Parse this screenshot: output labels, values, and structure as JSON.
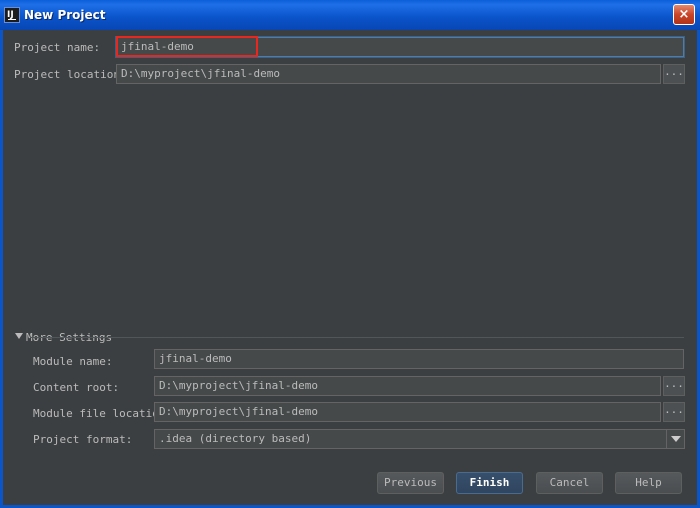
{
  "window": {
    "title": "New Project",
    "app_icon_letters": "IJ",
    "close_symbol": "×"
  },
  "form": {
    "project_name_label": "Project name:",
    "project_name_value": "jfinal-demo",
    "project_location_label": "Project location:",
    "project_location_value": "D:\\myproject\\jfinal-demo",
    "browse_label": "..."
  },
  "more_settings": {
    "header": "More Settings",
    "module_name_label": "Module name:",
    "module_name_value": "jfinal-demo",
    "content_root_label": "Content root:",
    "content_root_value": "D:\\myproject\\jfinal-demo",
    "module_file_location_label": "Module file location:",
    "module_file_location_value": "D:\\myproject\\jfinal-demo",
    "project_format_label": "Project format:",
    "project_format_value": ".idea (directory based)"
  },
  "buttons": {
    "previous": "Previous",
    "finish": "Finish",
    "cancel": "Cancel",
    "help": "Help"
  },
  "colors": {
    "background": "#3c3f41",
    "title_bar": "#0a53c9",
    "highlight": "#e8281f",
    "default_button": "#2f4560"
  },
  "icons": [
    "intellij-app-icon",
    "close-icon",
    "browse-icon",
    "collapse-triangle-icon",
    "dropdown-arrow-icon"
  ]
}
